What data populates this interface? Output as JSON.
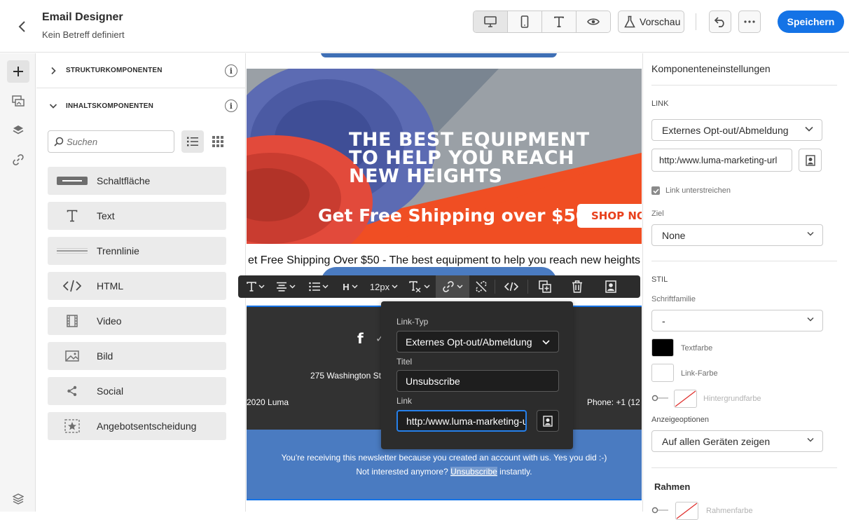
{
  "header": {
    "title": "Email Designer",
    "subtitle": "Kein Betreff definiert",
    "preview_label": "Vorschau",
    "save_label": "Speichern"
  },
  "components": {
    "sections": {
      "structure": "STRUKTURKOMPONENTEN",
      "content": "INHALTSKOMPONENTEN"
    },
    "search_placeholder": "Suchen",
    "items": [
      {
        "label": "Schaltfläche",
        "icon": "button-icon"
      },
      {
        "label": "Text",
        "icon": "text-icon"
      },
      {
        "label": "Trennlinie",
        "icon": "divider-icon"
      },
      {
        "label": "HTML",
        "icon": "html-code-icon"
      },
      {
        "label": "Video",
        "icon": "video-icon"
      },
      {
        "label": "Bild",
        "icon": "image-icon"
      },
      {
        "label": "Social",
        "icon": "share-icon"
      },
      {
        "label": "Angebotsentscheidung",
        "icon": "offer-decision-icon"
      }
    ]
  },
  "canvas": {
    "hero": {
      "line1": "THE BEST EQUIPMENT",
      "line2": "TO HELP YOU REACH",
      "line3": "NEW HEIGHTS",
      "shipping": "Get Free Shipping over $50",
      "shop_button": "SHOP NOW"
    },
    "caption": "et Free Shipping Over $50 - The best equipment to help you reach new heights",
    "address": "275 Washington St",
    "copyright": "2020 Luma",
    "phone": "Phone: +1 (12",
    "newsletter_line": "You're receiving this newsletter because you created an account with us. Yes you did :-)",
    "not_interested": "Not interested anymore?",
    "unsubscribe_link": "Unsubscribe",
    "instantly": "instantly."
  },
  "toolbar": {
    "font_size": "12px",
    "heading_label": "H"
  },
  "link_popover": {
    "link_type_label": "Link-Typ",
    "link_type_value": "Externes Opt-out/Abmeldung",
    "title_label": "Titel",
    "title_value": "Unsubscribe",
    "link_label": "Link",
    "link_value": "http:/www.luma-marketing-url"
  },
  "settings": {
    "title": "Komponenteneinstellungen",
    "link_caption": "LINK",
    "link_type_value": "Externes Opt-out/Abmeldung",
    "url_value": "http:/www.luma-marketing-url",
    "underline_label": "Link unterstreichen",
    "target_label": "Ziel",
    "target_value": "None",
    "style_caption": "STIL",
    "font_family_label": "Schriftfamilie",
    "font_family_value": "-",
    "text_color_label": "Textfarbe",
    "link_color_label": "Link-Farbe",
    "background_color_label": "Hintergrundfarbe",
    "display_options_label": "Anzeigeoptionen",
    "display_options_value": "Auf allen Geräten zeigen",
    "border_label": "Rahmen",
    "border_color_label": "Rahmenfarbe"
  },
  "colors": {
    "accent": "#1473e6",
    "text_color_swatch": "#000000",
    "link_color_swatch": "#ffffff",
    "footer_dark": "#323232",
    "footer_blue": "#4a7bc1",
    "hero_orange": "#f04e23"
  }
}
